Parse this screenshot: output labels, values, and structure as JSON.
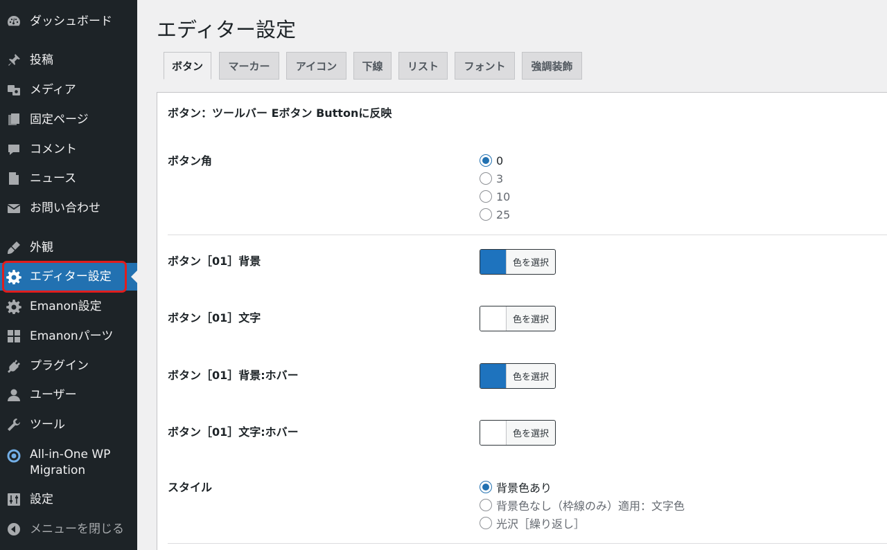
{
  "sidebar": {
    "items": [
      {
        "label": "ダッシュボード",
        "icon": "dashboard-icon"
      },
      {
        "label": "投稿",
        "icon": "pin-icon"
      },
      {
        "label": "メディア",
        "icon": "media-icon"
      },
      {
        "label": "固定ページ",
        "icon": "pages-icon"
      },
      {
        "label": "コメント",
        "icon": "comment-icon"
      },
      {
        "label": "ニュース",
        "icon": "news-icon"
      },
      {
        "label": "お問い合わせ",
        "icon": "mail-icon"
      },
      {
        "label": "外観",
        "icon": "appearance-icon"
      },
      {
        "label": "エディター設定",
        "icon": "gear-icon"
      },
      {
        "label": "Emanon設定",
        "icon": "gear-icon"
      },
      {
        "label": "Emanonパーツ",
        "icon": "grid-icon"
      },
      {
        "label": "プラグイン",
        "icon": "plugin-icon"
      },
      {
        "label": "ユーザー",
        "icon": "user-icon"
      },
      {
        "label": "ツール",
        "icon": "wrench-icon"
      },
      {
        "label": "All-in-One WP\nMigration",
        "icon": "migration-icon"
      },
      {
        "label": "設定",
        "icon": "settings-icon"
      },
      {
        "label": "メニューを閉じる",
        "icon": "collapse-icon"
      }
    ],
    "active_index": 8
  },
  "page": {
    "title": "エディター設定"
  },
  "tabs": [
    {
      "label": "ボタン",
      "active": true
    },
    {
      "label": "マーカー",
      "active": false
    },
    {
      "label": "アイコン",
      "active": false
    },
    {
      "label": "下線",
      "active": false
    },
    {
      "label": "リスト",
      "active": false
    },
    {
      "label": "フォント",
      "active": false
    },
    {
      "label": "強調装飾",
      "active": false
    }
  ],
  "panel": {
    "section_title": "ボタン：ツールバー Eボタン Buttonに反映",
    "corner": {
      "label": "ボタン角",
      "options": [
        "0",
        "3",
        "10",
        "25"
      ],
      "selected": "0"
    },
    "colors": [
      {
        "label": "ボタン［01］背景",
        "button": "色を選択",
        "swatch": "#1e73be"
      },
      {
        "label": "ボタン［01］文字",
        "button": "色を選択",
        "swatch": "#ffffff"
      },
      {
        "label": "ボタン［01］背景:ホバー",
        "button": "色を選択",
        "swatch": "#1e73be"
      },
      {
        "label": "ボタン［01］文字:ホバー",
        "button": "色を選択",
        "swatch": "#ffffff"
      }
    ],
    "style": {
      "label": "スタイル",
      "options": [
        "背景色あり",
        "背景色なし（枠線のみ）適用：文字色",
        "光沢［繰り返し］"
      ],
      "selected": "背景色あり"
    }
  },
  "colors": {
    "sidebar_bg": "#1d2327",
    "accent": "#2271b1",
    "highlight": "#e11d1d"
  }
}
